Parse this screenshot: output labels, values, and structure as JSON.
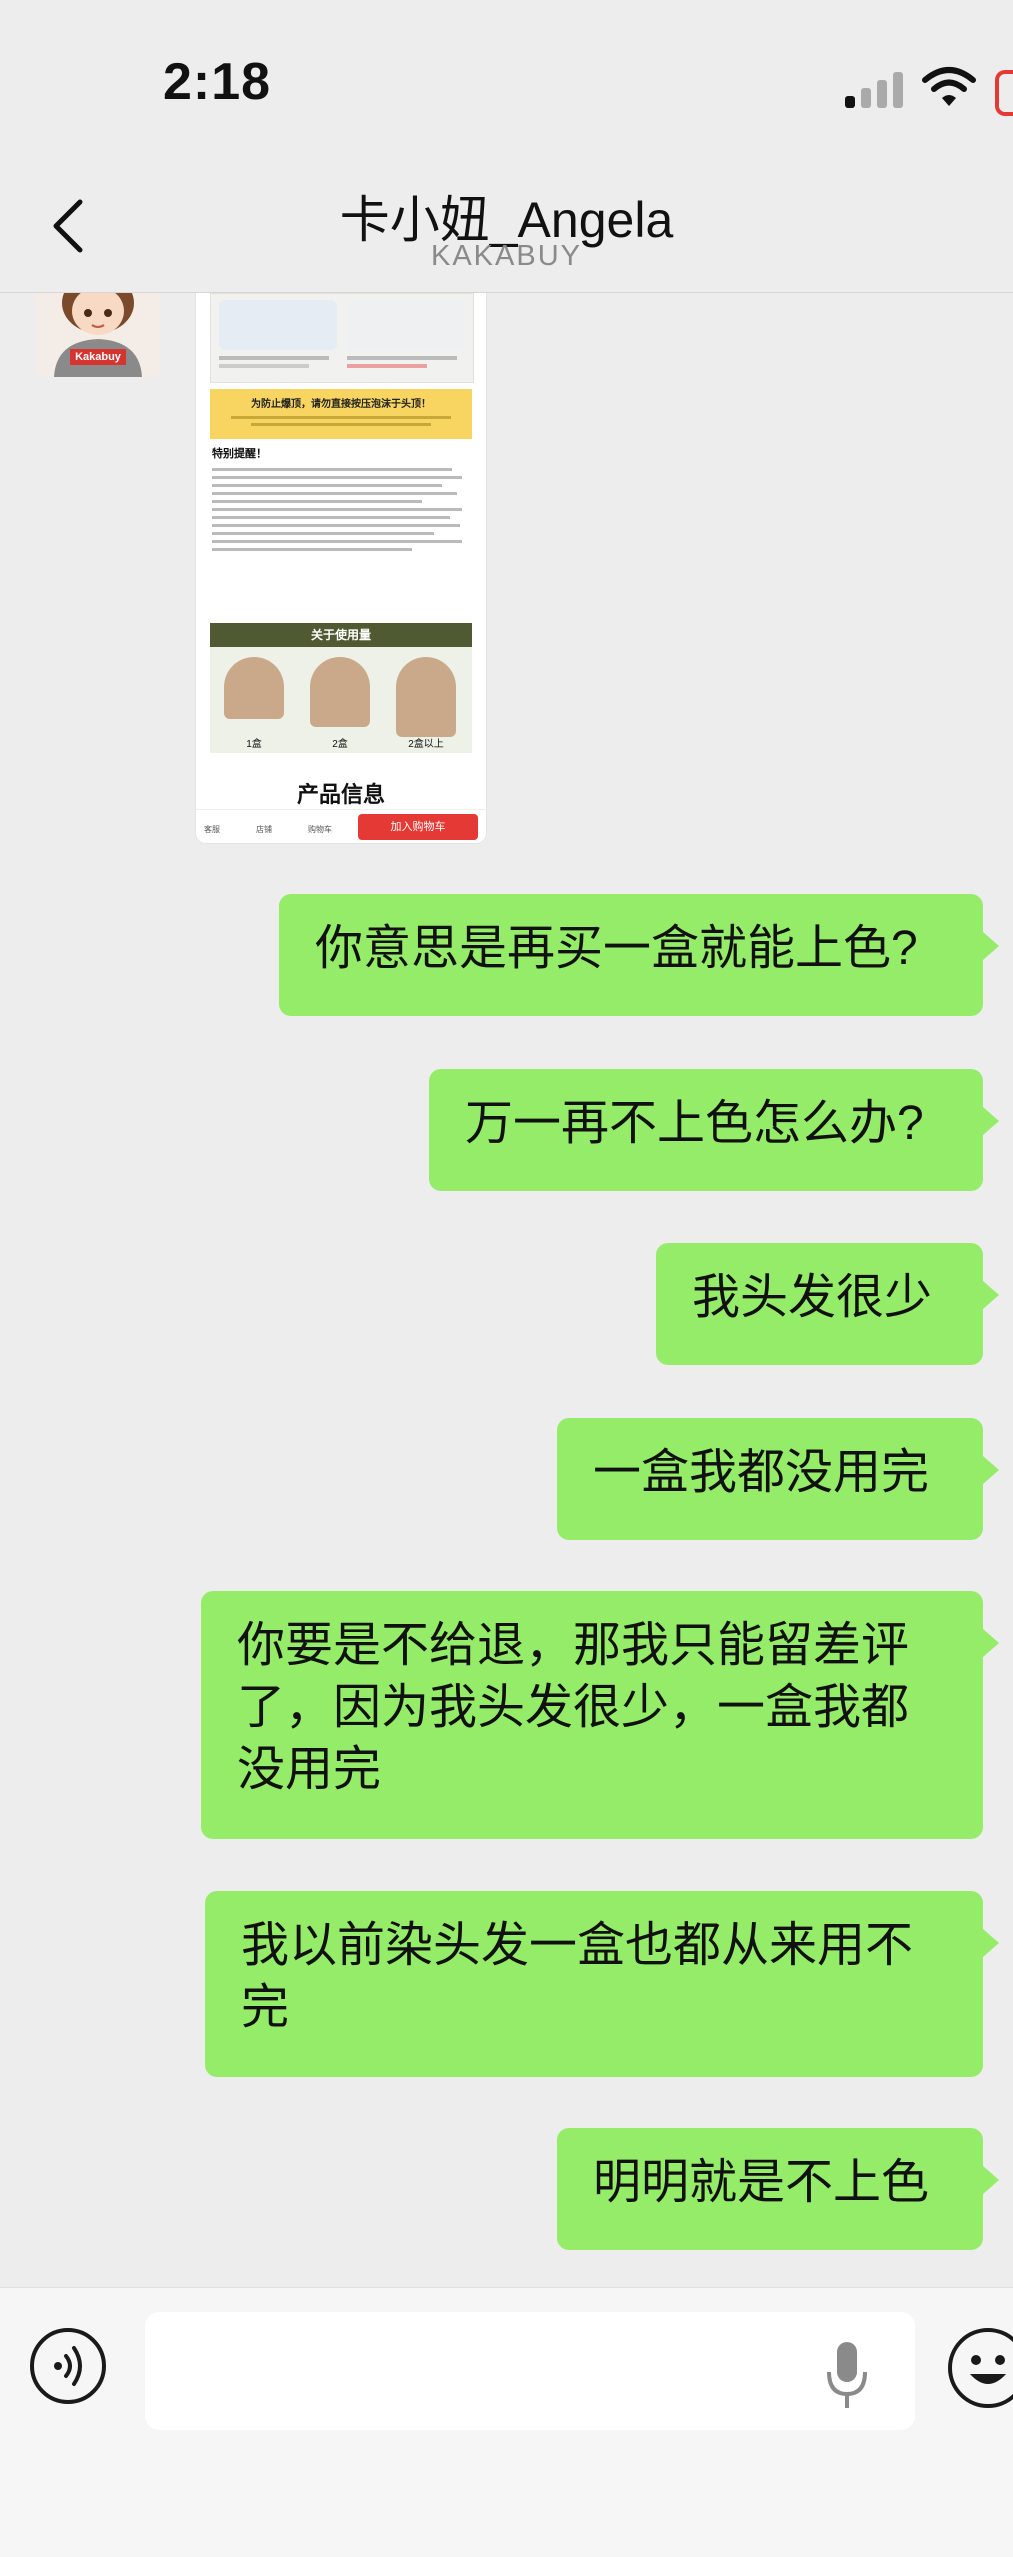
{
  "status_bar": {
    "time": "2:18",
    "signal_icon": "cellular-signal-icon",
    "wifi_icon": "wifi-icon",
    "battery_icon": "battery-icon"
  },
  "header": {
    "back_icon": "chevron-left-icon",
    "title": "卡小妞_Angela",
    "subtitle": "KAKABUY"
  },
  "incoming_image": {
    "avatar_badge": "Kakabuy",
    "caption_banner": "为防止爆顶，请勿直接按压泡沫于头顶！",
    "section_title": "关于使用量",
    "usage_levels": [
      "1盒",
      "2盒",
      "2盒以上"
    ],
    "bottom_heading": "产品信息",
    "nav_items": [
      "客服",
      "店铺",
      "购物车"
    ],
    "cart_button": "加入购物车",
    "notes_title": "特别提醒！"
  },
  "messages": [
    {
      "sender": "me",
      "text": "你意思是再买一盒就能上色?"
    },
    {
      "sender": "me",
      "text": "万一再不上色怎么办?"
    },
    {
      "sender": "me",
      "text": "我头发很少"
    },
    {
      "sender": "me",
      "text": "一盒我都没用完"
    },
    {
      "sender": "me",
      "text": "你要是不给退，那我只能留差评了，因为我头发很少，一盒我都没用完"
    },
    {
      "sender": "me",
      "text": "我以前染头发一盒也都从来用不完"
    },
    {
      "sender": "me",
      "text": "明明就是不上色"
    }
  ],
  "input_bar": {
    "voice_icon": "voice-mode-icon",
    "placeholder": "",
    "mic_icon": "microphone-icon",
    "emoji_icon": "emoji-icon"
  },
  "colors": {
    "bubble_green": "#95ec69",
    "background": "#ededed",
    "badge_red": "#d6342f"
  }
}
